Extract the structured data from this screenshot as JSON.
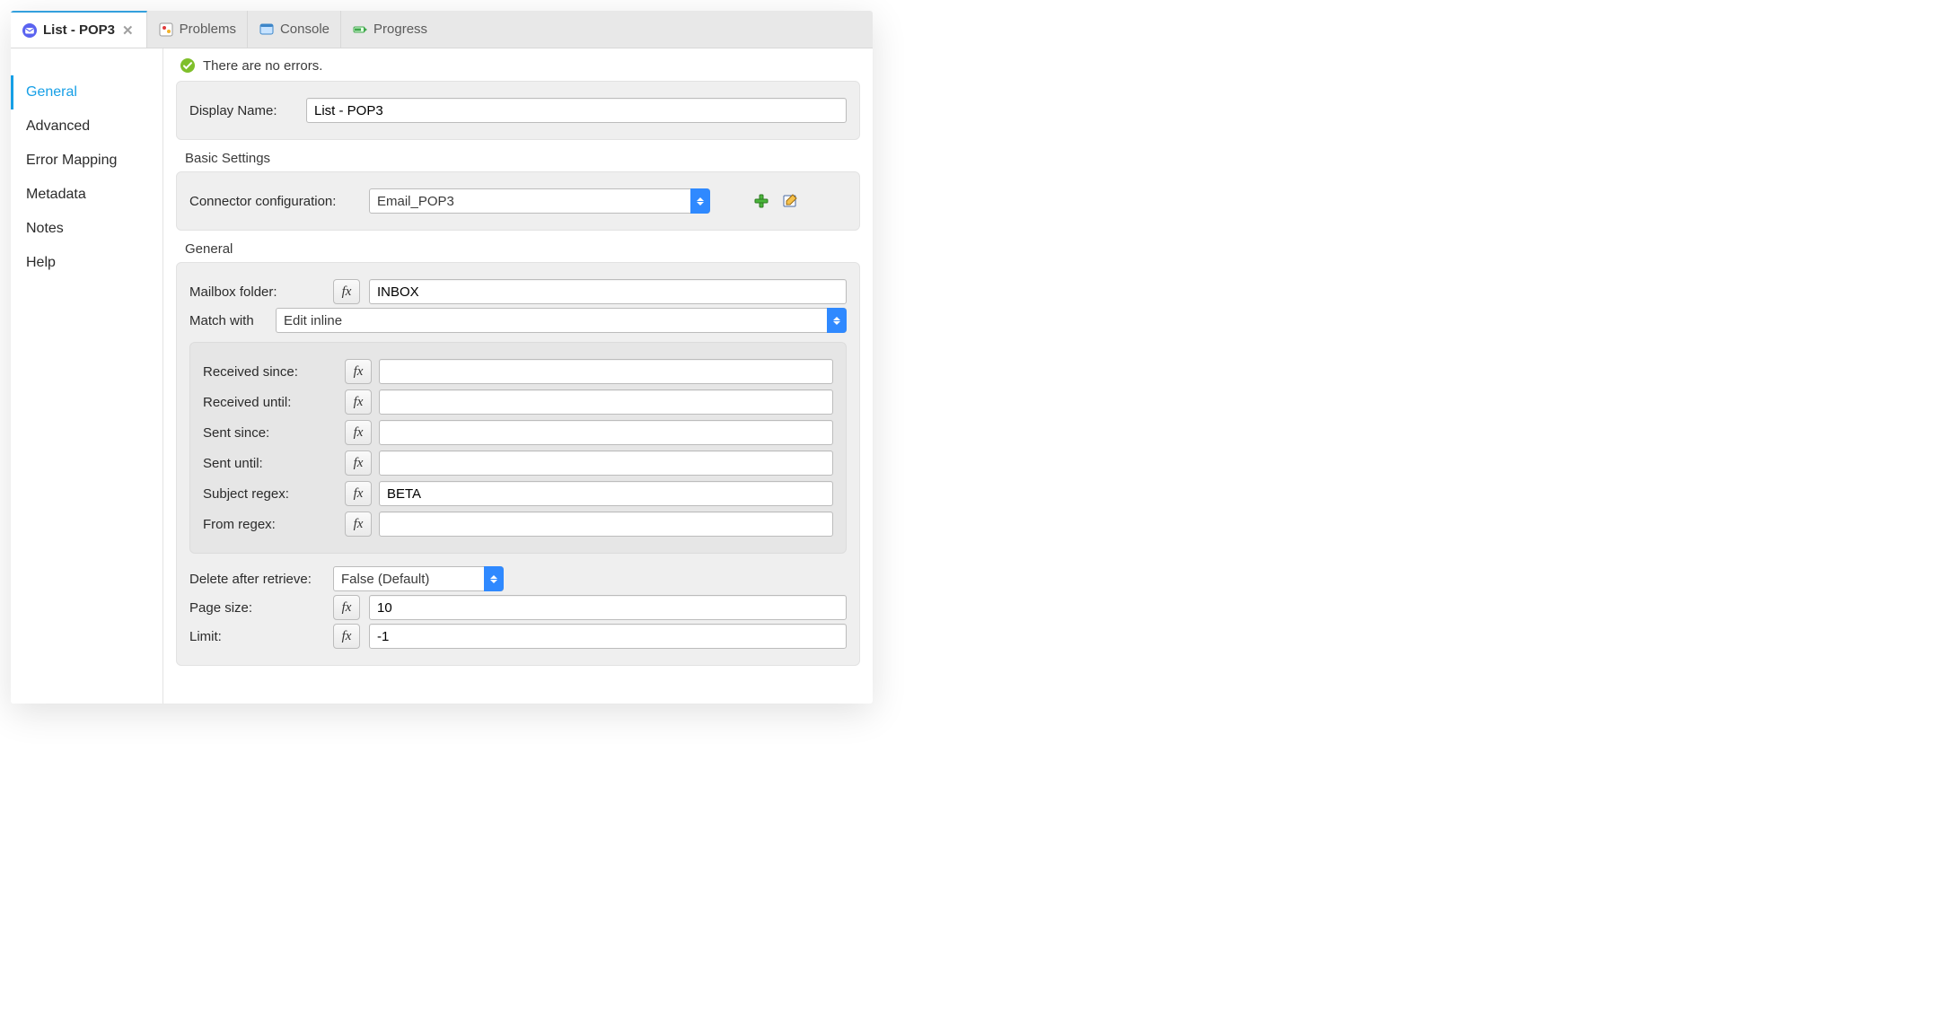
{
  "tabs": {
    "active": {
      "label": "List - POP3"
    },
    "others": [
      {
        "label": "Problems"
      },
      {
        "label": "Console"
      },
      {
        "label": "Progress"
      }
    ]
  },
  "sidebar": {
    "items": [
      {
        "label": "General",
        "active": true
      },
      {
        "label": "Advanced"
      },
      {
        "label": "Error Mapping"
      },
      {
        "label": "Metadata"
      },
      {
        "label": "Notes"
      },
      {
        "label": "Help"
      }
    ]
  },
  "status": {
    "message": "There are no errors."
  },
  "displayName": {
    "label": "Display Name:",
    "value": "List - POP3"
  },
  "basicSettings": {
    "title": "Basic Settings",
    "connectorConfig": {
      "label": "Connector configuration:",
      "value": "Email_POP3"
    }
  },
  "general": {
    "title": "General",
    "mailboxFolder": {
      "label": "Mailbox folder:",
      "value": "INBOX"
    },
    "matchWith": {
      "label": "Match with",
      "value": "Edit inline"
    },
    "receivedSince": {
      "label": "Received since:",
      "value": ""
    },
    "receivedUntil": {
      "label": "Received until:",
      "value": ""
    },
    "sentSince": {
      "label": "Sent since:",
      "value": ""
    },
    "sentUntil": {
      "label": "Sent until:",
      "value": ""
    },
    "subjectRegex": {
      "label": "Subject regex:",
      "value": "BETA"
    },
    "fromRegex": {
      "label": "From regex:",
      "value": ""
    },
    "deleteAfterRetrieve": {
      "label": "Delete after retrieve:",
      "value": "False (Default)"
    },
    "pageSize": {
      "label": "Page size:",
      "value": "10"
    },
    "limit": {
      "label": "Limit:",
      "value": "-1"
    }
  },
  "fxLabel": "fx"
}
